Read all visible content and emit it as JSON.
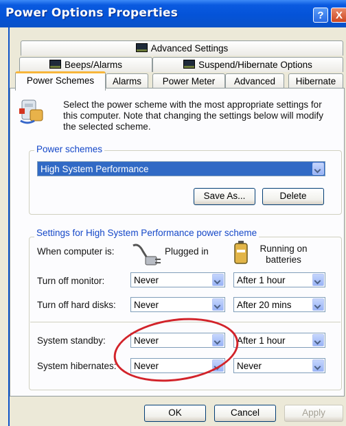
{
  "window": {
    "title": "Power Options Properties",
    "help_label": "?",
    "close_label": "X"
  },
  "tabs": {
    "row1": [
      {
        "label": "Advanced Settings",
        "icon": "monitor-icon"
      }
    ],
    "row2": [
      {
        "label": "Beeps/Alarms",
        "icon": "monitor-icon"
      },
      {
        "label": "Suspend/Hibernate Options",
        "icon": "monitor-icon"
      }
    ],
    "row3": [
      {
        "label": "Power Schemes",
        "active": true
      },
      {
        "label": "Alarms"
      },
      {
        "label": "Power Meter"
      },
      {
        "label": "Advanced"
      },
      {
        "label": "Hibernate"
      }
    ]
  },
  "intro": {
    "text": "Select the power scheme with the most appropriate settings for this computer. Note that changing the settings below will modify the selected scheme.",
    "icon": "power-scheme-icon"
  },
  "power_schemes": {
    "legend": "Power schemes",
    "selected": "High System Performance",
    "save_as_label": "Save As...",
    "delete_label": "Delete"
  },
  "settings": {
    "legend": "Settings for High System Performance power scheme",
    "when_label": "When computer is:",
    "plugged_label": "Plugged in",
    "battery_label": "Running on batteries",
    "rows": [
      {
        "label": "Turn off monitor:",
        "plugged": "Never",
        "battery": "After 1 hour"
      },
      {
        "label": "Turn off hard disks:",
        "plugged": "Never",
        "battery": "After 20 mins"
      },
      {
        "label": "System standby:",
        "plugged": "Never",
        "battery": "After 1 hour"
      },
      {
        "label": "System hibernates:",
        "plugged": "Never",
        "battery": "Never"
      }
    ]
  },
  "footer": {
    "ok_label": "OK",
    "cancel_label": "Cancel",
    "apply_label": "Apply"
  },
  "colors": {
    "accent": "#0a52c8",
    "highlight": "#316ac5",
    "annotation": "#d2232a"
  }
}
